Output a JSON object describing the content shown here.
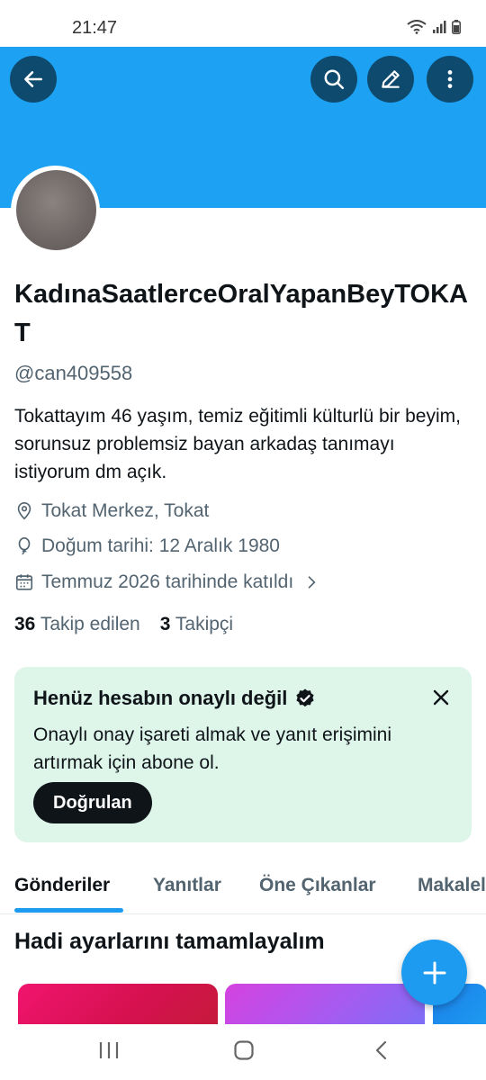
{
  "status_bar": {
    "time": "21:47"
  },
  "header": {
    "banner_color": "#1da1f2",
    "back_icon": "arrow-left-icon",
    "search_icon": "search-icon",
    "edit_icon": "pencil-icon",
    "more_icon": "more-vertical-icon"
  },
  "profile": {
    "display_name": "KadınaSaatlerceOralYapanBeyTOKAT",
    "handle": "@can409558",
    "bio": "Tokattayım 46 yaşım, temiz eğitimli külturlü bir beyim, sorunsuz problemsiz bayan arkadaş tanımayı istiyorum dm açık.",
    "location": "Tokat Merkez, Tokat",
    "birthday": "Doğum tarihi: 12 Aralık 1980",
    "joined": "Temmuz 2026 tarihinde katıldı",
    "following_count": "36",
    "following_label": "Takip edilen",
    "followers_count": "3",
    "followers_label": "Takipçi"
  },
  "verify_card": {
    "title": "Henüz hesabın onaylı değil",
    "description": "Onaylı onay işareti almak ve yanıt erişimini artırmak için abone ol.",
    "button_label": "Doğrulan",
    "background": "#def5ea"
  },
  "tabs": [
    {
      "label": "Gönderiler",
      "active": true
    },
    {
      "label": "Yanıtlar",
      "active": false
    },
    {
      "label": "Öne Çıkanlar",
      "active": false
    },
    {
      "label": "Makaleler",
      "active": false
    }
  ],
  "setup_section": {
    "title": "Hadi ayarlarını tamamlayalım"
  },
  "accent_color": "#1d9bf0"
}
